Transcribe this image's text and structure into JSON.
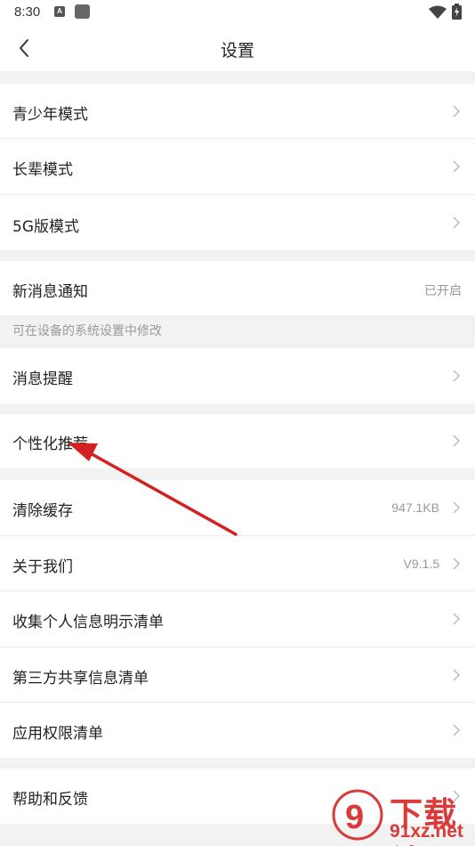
{
  "status_bar": {
    "time": "8:30",
    "notif_letter": "A"
  },
  "nav": {
    "title": "设置"
  },
  "groups": [
    {
      "items": [
        {
          "label": "青少年模式"
        },
        {
          "label": "长辈模式"
        },
        {
          "label": "5G版模式"
        }
      ]
    },
    {
      "items": [
        {
          "label": "新消息通知",
          "value": "已开启"
        }
      ],
      "hint": "可在设备的系统设置中修改"
    },
    {
      "items": [
        {
          "label": "消息提醒"
        }
      ]
    },
    {
      "items": [
        {
          "label": "个性化推荐"
        }
      ]
    },
    {
      "items": [
        {
          "label": "清除缓存",
          "value": "947.1KB"
        },
        {
          "label": "关于我们",
          "value": "V9.1.5"
        },
        {
          "label": "收集个人信息明示清单"
        },
        {
          "label": "第三方共享信息清单"
        },
        {
          "label": "应用权限清单"
        }
      ]
    },
    {
      "items": [
        {
          "label": "帮助和反馈"
        }
      ]
    }
  ],
  "watermark": {
    "brand": "下载站",
    "url": "91xz.net",
    "logo_glyph": "9"
  },
  "colors": {
    "annotation_arrow": "#d32020",
    "watermark": "#d93a3a"
  }
}
